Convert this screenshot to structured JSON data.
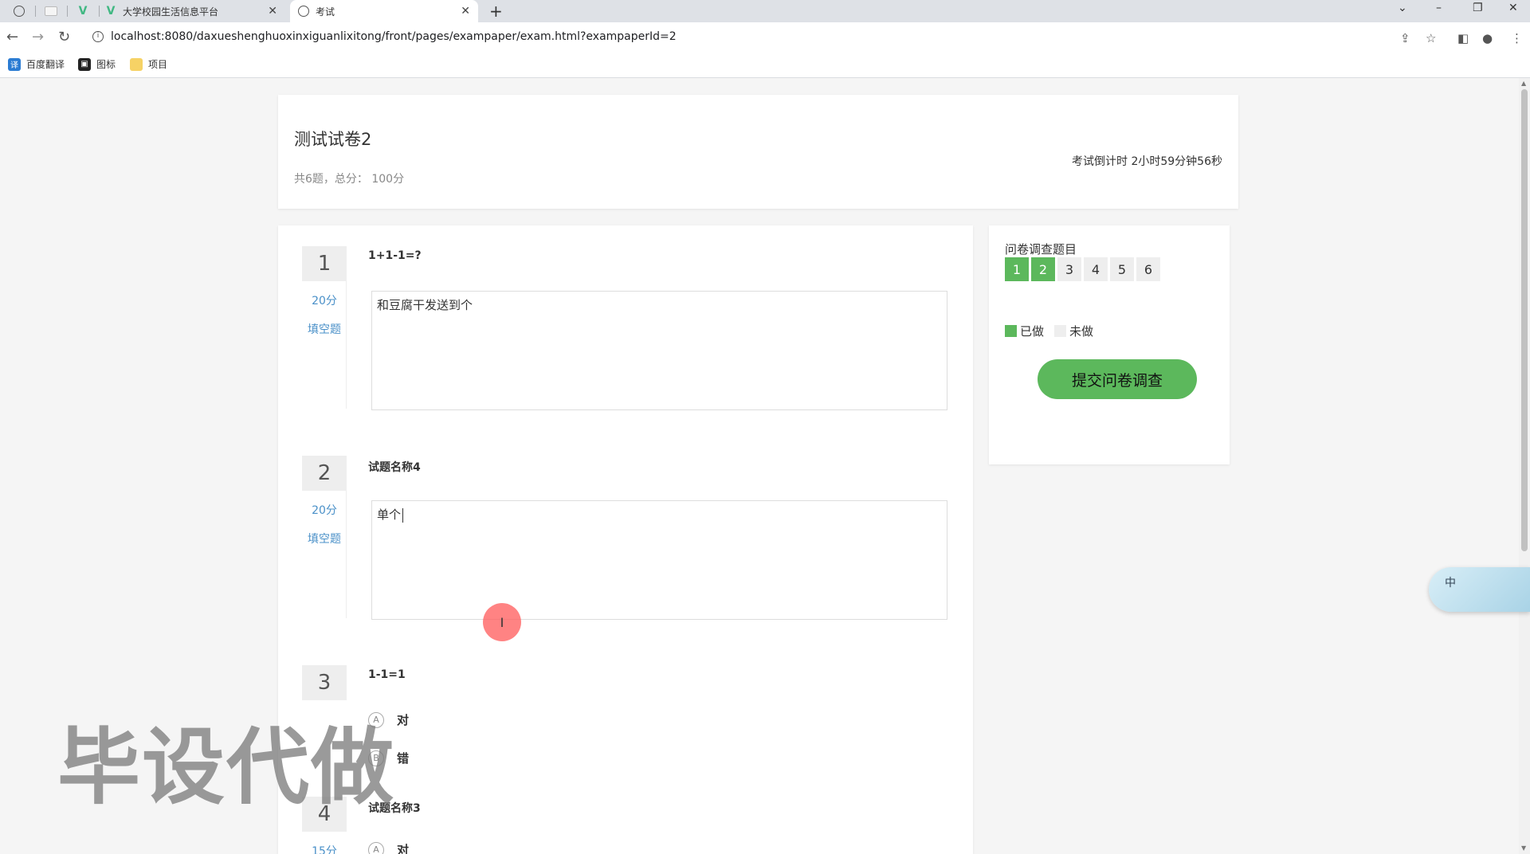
{
  "browser": {
    "tabs": [
      {
        "title": "大学校园生活信息平台",
        "active": false
      },
      {
        "title": "考试",
        "active": true
      }
    ],
    "url": "localhost:8080/daxueshenghuoxinxiguanlixitong/front/pages/exampaper/exam.html?exampaperId=2",
    "bookmarks": [
      "百度翻译",
      "图标",
      "项目"
    ]
  },
  "exam": {
    "title": "测试试卷2",
    "meta": "共6题，总分： 100分",
    "countdown": "考试倒计时 2小时59分钟56秒"
  },
  "questions": [
    {
      "number": "1",
      "score": "20分",
      "type": "填空题",
      "title": "1+1-1=?",
      "answer": "和豆腐干发送到个"
    },
    {
      "number": "2",
      "score": "20分",
      "type": "填空题",
      "title": "试题名称4",
      "answer": "单个"
    },
    {
      "number": "3",
      "title": "1-1=1",
      "options": [
        {
          "letter": "A",
          "text": "对"
        },
        {
          "letter": "B",
          "text": "错"
        }
      ]
    },
    {
      "number": "4",
      "score": "15分",
      "title": "试题名称3",
      "options": [
        {
          "letter": "A",
          "text": "对"
        }
      ]
    }
  ],
  "sidebar": {
    "title": "问卷调查题目",
    "nav": [
      {
        "label": "1",
        "done": true
      },
      {
        "label": "2",
        "done": true
      },
      {
        "label": "3",
        "done": false
      },
      {
        "label": "4",
        "done": false
      },
      {
        "label": "5",
        "done": false
      },
      {
        "label": "6",
        "done": false
      }
    ],
    "legend_done": "已做",
    "legend_todo": "未做",
    "submit_label": "提交问卷调查"
  },
  "overlays": {
    "watermark": "毕设代做",
    "ime_label": "中"
  },
  "colors": {
    "accent_green": "#5cb85c",
    "link_blue": "#4a90c8",
    "cursor_highlight": "#ff5a5a"
  }
}
